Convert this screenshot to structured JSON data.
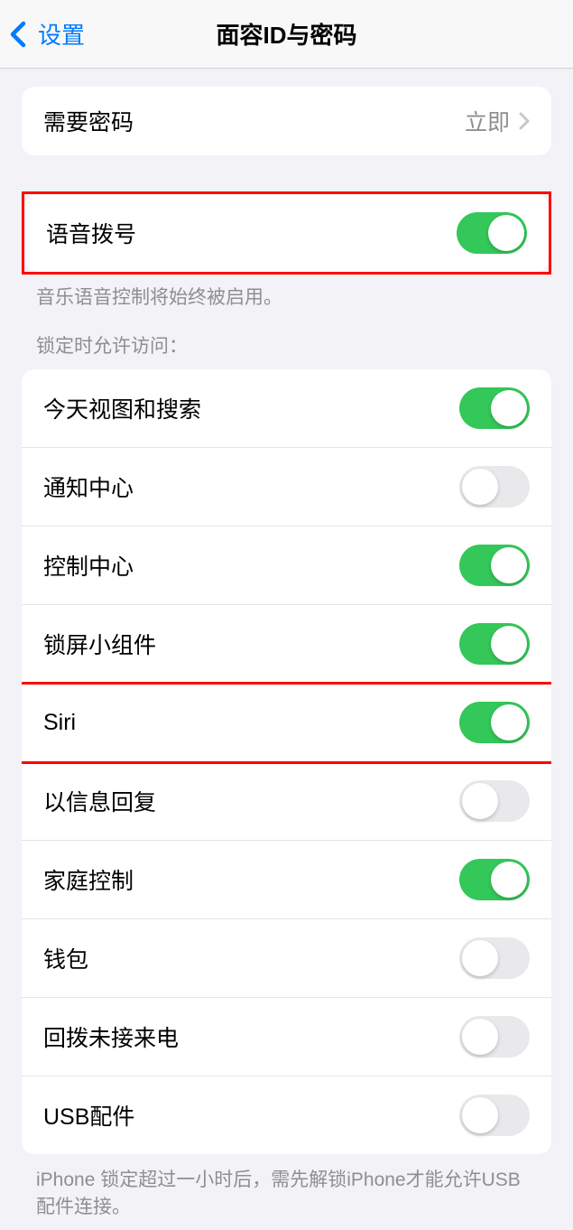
{
  "header": {
    "back_label": "设置",
    "title": "面容ID与密码"
  },
  "require_passcode": {
    "label": "需要密码",
    "value": "立即"
  },
  "voice_dial": {
    "label": "语音拨号",
    "on": true,
    "footer": "音乐语音控制将始终被启用。"
  },
  "lock_access": {
    "header": "锁定时允许访问：",
    "items": [
      {
        "label": "今天视图和搜索",
        "on": true
      },
      {
        "label": "通知中心",
        "on": false
      },
      {
        "label": "控制中心",
        "on": true
      },
      {
        "label": "锁屏小组件",
        "on": true
      },
      {
        "label": "Siri",
        "on": true
      },
      {
        "label": "以信息回复",
        "on": false
      },
      {
        "label": "家庭控制",
        "on": true
      },
      {
        "label": "钱包",
        "on": false
      },
      {
        "label": "回拨未接来电",
        "on": false
      },
      {
        "label": "USB配件",
        "on": false
      }
    ],
    "footer": "iPhone 锁定超过一小时后，需先解锁iPhone才能允许USB 配件连接。"
  }
}
